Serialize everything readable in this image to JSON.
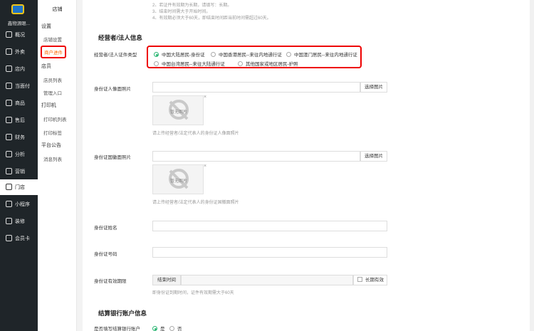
{
  "nav": {
    "shop_name": "鑫物源眼...",
    "items": [
      {
        "label": "概况",
        "icon": "overview-icon"
      },
      {
        "label": "外卖",
        "icon": "delivery-icon"
      },
      {
        "label": "店内",
        "icon": "store-icon"
      },
      {
        "label": "当面付",
        "icon": "pay-icon"
      },
      {
        "label": "商品",
        "icon": "goods-icon"
      },
      {
        "label": "售后",
        "icon": "aftersale-icon"
      },
      {
        "label": "财务",
        "icon": "finance-icon"
      },
      {
        "label": "分析",
        "icon": "analysis-icon"
      },
      {
        "label": "营销",
        "icon": "marketing-icon"
      },
      {
        "label": "门店",
        "icon": "shop-icon"
      },
      {
        "label": "小程序",
        "icon": "miniapp-icon"
      },
      {
        "label": "装修",
        "icon": "decorate-icon"
      },
      {
        "label": "会员卡",
        "icon": "member-card-icon"
      }
    ]
  },
  "subnav": {
    "header": "店铺",
    "groups": [
      {
        "title": "设置",
        "items": [
          "店铺设置",
          "商户进件"
        ]
      },
      {
        "title": "店员",
        "items": [
          "店员列表",
          "管理入口"
        ]
      },
      {
        "title": "打印机",
        "items": [
          "打印机列表",
          "打印标签"
        ]
      },
      {
        "title": "平台公告",
        "items": [
          "消息列表"
        ]
      }
    ]
  },
  "notes": [
    "2、若证件有效期为长期，请填写：长期。",
    "3、结束时间需大于开始时间。",
    "4、有效期必须大于60天，即结束时间距当前时间需超过60天。"
  ],
  "legal": {
    "section_title": "经营者/法人信息",
    "id_type_label": "经营者/法人证件类型",
    "id_types": [
      "中国大陆居民-身份证",
      "中国香港居民--来往内地通行证",
      "中国澳门居民--来往内地通行证",
      "中国台湾居民--来往大陆通行证",
      "其他国家或地区居民-护照"
    ],
    "front_label": "身份证人像面照片",
    "front_hint": "请上传经营者/法定代表人的身份证人像面照片",
    "back_label": "身份证国徽面照片",
    "back_hint": "请上传经营者/法定代表人的身份证国徽面照片",
    "select_image": "选择图片",
    "placeholder_text": "暂无图片",
    "close": "×",
    "name_label": "身份证姓名",
    "number_label": "身份证号码",
    "validity_label": "身份证有效期限",
    "end_time": "结束时间",
    "long_term": "长期有效",
    "validity_hint": "即身份证到期时间，证件有效期需大于60天"
  },
  "bank": {
    "section_title": "结算银行账户信息",
    "fill_label": "是否填写结算银行账户",
    "yes": "是",
    "no": "否"
  }
}
